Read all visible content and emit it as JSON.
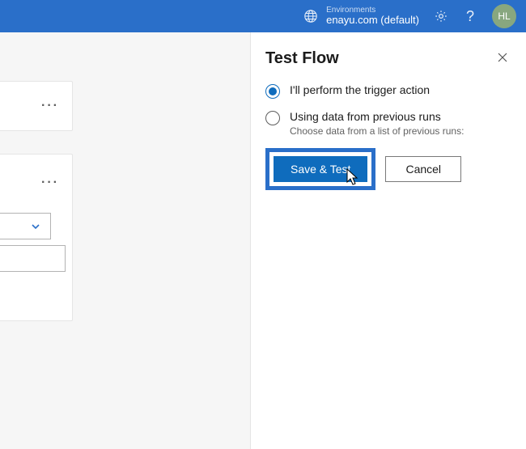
{
  "header": {
    "env_label": "Environments",
    "env_value": "enayu.com (default)",
    "avatar": "HL"
  },
  "panel": {
    "title": "Test Flow",
    "radios": {
      "option1": "I'll perform the trigger action",
      "option2": "Using data from previous runs",
      "option2_sub": "Choose data from a list of previous runs:"
    },
    "buttons": {
      "primary": "Save & Test",
      "secondary": "Cancel"
    }
  }
}
